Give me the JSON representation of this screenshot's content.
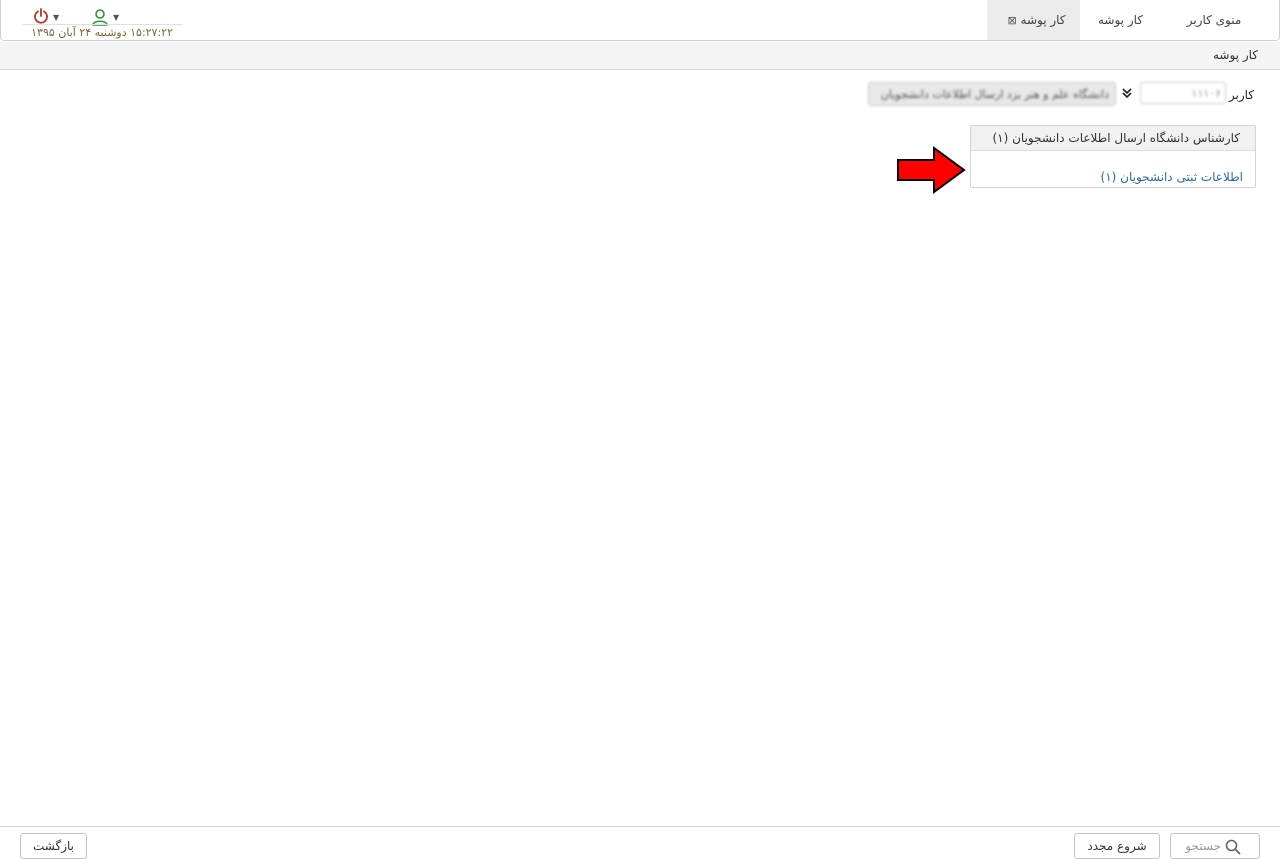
{
  "topbar": {
    "tabs": [
      {
        "label": "منوی کاربر"
      },
      {
        "label": "کار پوشه"
      },
      {
        "label": "کار پوشه",
        "close_icon": "⊠"
      }
    ],
    "datetime": "۱۵:۲۷:۲۲ دوشنبه ۲۴ آبان ۱۳۹۵",
    "icons": {
      "power": "power-icon",
      "user": "user-icon"
    },
    "colors": {
      "power": "#a23a2e",
      "user": "#3a8a3a"
    }
  },
  "breadcrumb": {
    "title": "کار پوشه"
  },
  "user_row": {
    "label": "کاربر",
    "user_code": "۱۱۱۰۶",
    "org_value": "دانشگاه علم و هنر یزد ارسال اطلاعات دانشجویان"
  },
  "card": {
    "header": "کارشناس دانشگاه ارسال اطلاعات دانشجویان (۱)",
    "link": "اطلاعات ثبتی دانشجویان (۱)",
    "link_color": "#2f6a9a"
  },
  "annotation": {
    "arrow_color": "#ff0000"
  },
  "footer": {
    "search_label": "جستجو",
    "restart_label": "شروع مجدد",
    "back_label": "بازگشت"
  }
}
